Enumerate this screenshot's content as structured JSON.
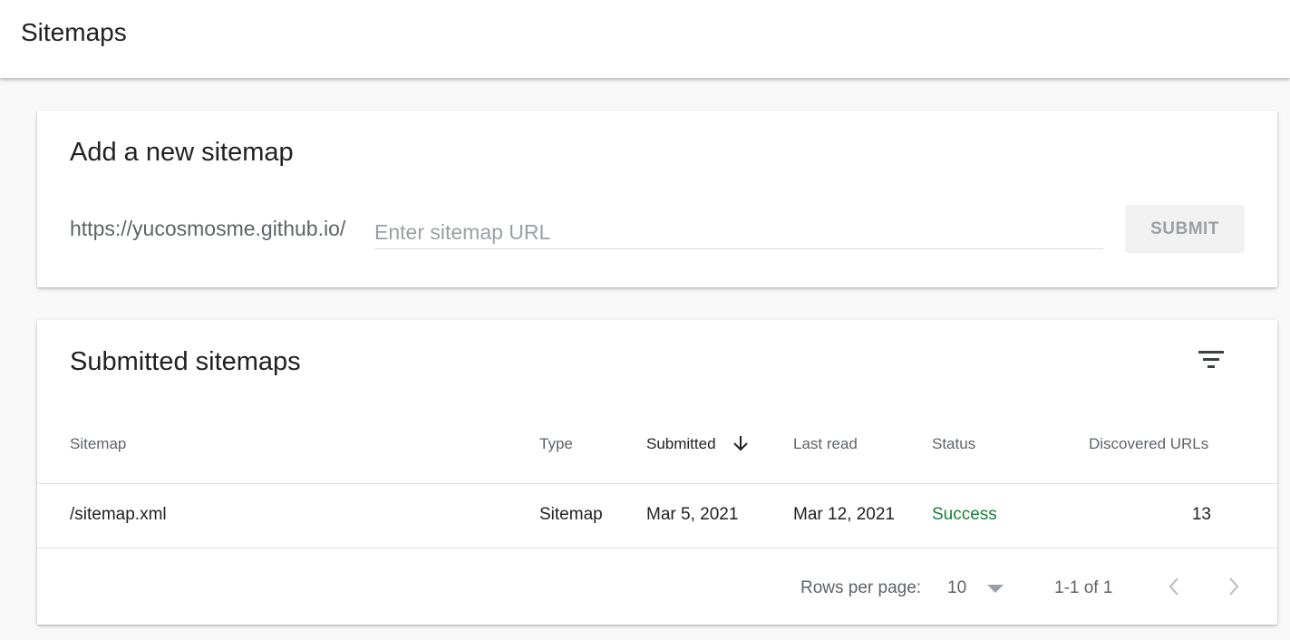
{
  "header": {
    "title": "Sitemaps"
  },
  "add_card": {
    "title": "Add a new sitemap",
    "url_prefix": "https://yucosmosme.github.io/",
    "input_value": "",
    "input_placeholder": "Enter sitemap URL",
    "submit_label": "SUBMIT"
  },
  "list_card": {
    "title": "Submitted sitemaps",
    "columns": {
      "sitemap": "Sitemap",
      "type": "Type",
      "submitted": "Submitted",
      "last_read": "Last read",
      "status": "Status",
      "discovered": "Discovered URLs"
    },
    "sort_column": "submitted",
    "sort_direction": "descending",
    "rows": [
      {
        "sitemap": "/sitemap.xml",
        "type": "Sitemap",
        "submitted": "Mar 5, 2021",
        "last_read": "Mar 12, 2021",
        "status": "Success",
        "discovered": "13"
      }
    ],
    "footer": {
      "rows_per_page_label": "Rows per page:",
      "rows_per_page_value": "10",
      "range": "1-1 of 1"
    }
  },
  "colors": {
    "status_success": "#188038",
    "muted_text": "#5f6368",
    "primary_text": "#202124"
  },
  "icons": {
    "filter": "filter-icon",
    "sort": "arrow-down-icon",
    "dropdown": "caret-down-icon",
    "prev": "chevron-left-icon",
    "next": "chevron-right-icon"
  }
}
